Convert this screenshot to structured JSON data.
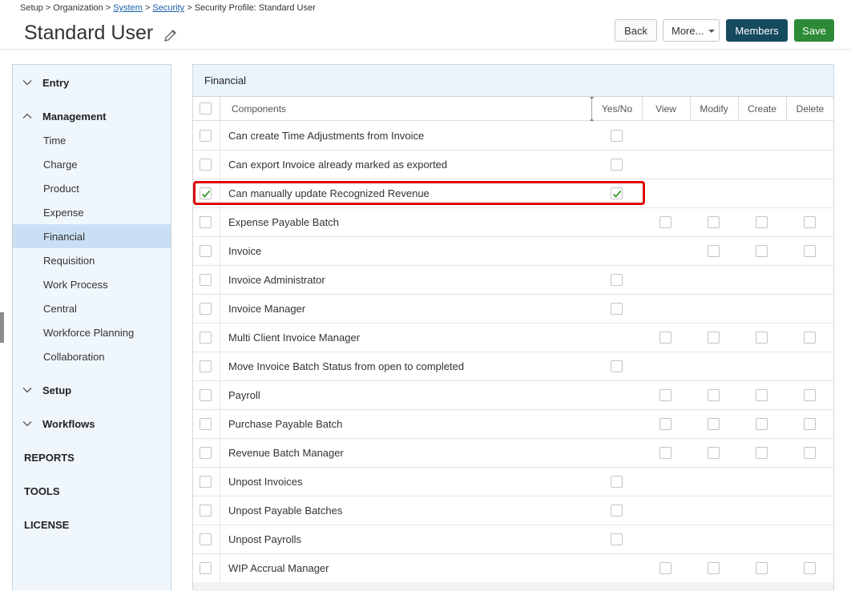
{
  "breadcrumb": {
    "part1": "Setup > Organization > ",
    "system": "System",
    "sep1": " > ",
    "security": "Security",
    "sep2": " > ",
    "current": "Security Profile: Standard User"
  },
  "page": {
    "title": "Standard User"
  },
  "toolbar": {
    "back": "Back",
    "more": "More...",
    "members": "Members",
    "save": "Save"
  },
  "sidebar": {
    "entry": "Entry",
    "management": "Management",
    "management_items": [
      "Time",
      "Charge",
      "Product",
      "Expense",
      "Financial",
      "Requisition",
      "Work Process",
      "Central",
      "Workforce Planning",
      "Collaboration"
    ],
    "active_item": "Financial",
    "setup": "Setup",
    "workflows": "Workflows",
    "reports": "REPORTS",
    "tools": "TOOLS",
    "license": "LICENSE"
  },
  "panel": {
    "title": "Financial",
    "columns": {
      "components": "Components",
      "yesno": "Yes/No",
      "view": "View",
      "modify": "Modify",
      "create": "Create",
      "delete": "Delete"
    },
    "rows": [
      {
        "label": "Can create Time Adjustments from Invoice",
        "type": "yesno",
        "checked": false
      },
      {
        "label": "Can export Invoice already marked as exported",
        "type": "yesno",
        "checked": false
      },
      {
        "label": "Can manually update Recognized Revenue",
        "type": "yesno",
        "checked": true
      },
      {
        "label": "Expense Payable Batch",
        "type": "crud4",
        "checked": false
      },
      {
        "label": "Invoice",
        "type": "crud3",
        "checked": false
      },
      {
        "label": "Invoice Administrator",
        "type": "yesno",
        "checked": false
      },
      {
        "label": "Invoice Manager",
        "type": "yesno",
        "checked": false
      },
      {
        "label": "Multi Client Invoice Manager",
        "type": "crud4",
        "checked": false
      },
      {
        "label": "Move Invoice Batch Status from open to completed",
        "type": "yesno",
        "checked": false
      },
      {
        "label": "Payroll",
        "type": "crud4",
        "checked": false
      },
      {
        "label": "Purchase Payable Batch",
        "type": "crud4",
        "checked": false
      },
      {
        "label": "Revenue Batch Manager",
        "type": "crud4",
        "checked": false
      },
      {
        "label": "Unpost Invoices",
        "type": "yesno",
        "checked": false
      },
      {
        "label": "Unpost Payable Batches",
        "type": "yesno",
        "checked": false
      },
      {
        "label": "Unpost Payrolls",
        "type": "yesno",
        "checked": false
      },
      {
        "label": "WIP Accrual Manager",
        "type": "crud4",
        "checked": false
      }
    ]
  },
  "colors": {
    "accent": "#164a5e",
    "save": "#2d8a36",
    "highlight": "#e00000",
    "check": "#3c9a2f",
    "active_nav": "#c9e0f4"
  }
}
